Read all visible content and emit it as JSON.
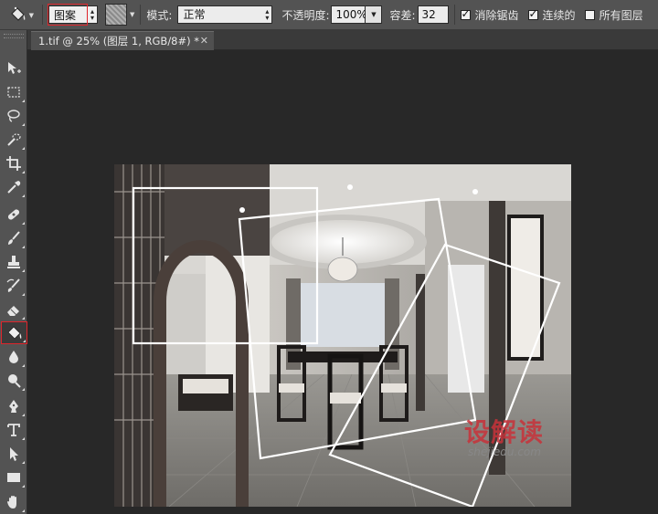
{
  "options_bar": {
    "tool_icon": "paint-bucket-icon",
    "fill_source": "图案",
    "pattern_icon": "pattern-swatch-icon",
    "mode_label": "模式:",
    "mode_value": "正常",
    "opacity_label": "不透明度:",
    "opacity_value": "100%",
    "tolerance_label": "容差:",
    "tolerance_value": "32",
    "anti_alias_label": "消除锯齿",
    "anti_alias_checked": true,
    "contiguous_label": "连续的",
    "contiguous_checked": true,
    "all_layers_label": "所有图层",
    "all_layers_checked": false
  },
  "document_tab": {
    "title": "1.tif @ 25% (图层 1, RGB/8#) *",
    "close_icon": "close-icon"
  },
  "toolbar": {
    "tools": [
      {
        "name": "move-tool",
        "icon": "move-icon"
      },
      {
        "name": "marquee-tool",
        "icon": "rect-marquee-icon"
      },
      {
        "name": "lasso-tool",
        "icon": "lasso-icon"
      },
      {
        "name": "quick-selection-tool",
        "icon": "quick-selection-icon"
      },
      {
        "name": "crop-tool",
        "icon": "crop-icon"
      },
      {
        "name": "eyedropper-tool",
        "icon": "eyedropper-icon"
      },
      {
        "name": "healing-brush-tool",
        "icon": "bandage-icon"
      },
      {
        "name": "brush-tool",
        "icon": "brush-icon"
      },
      {
        "name": "clone-stamp-tool",
        "icon": "stamp-icon"
      },
      {
        "name": "history-brush-tool",
        "icon": "history-brush-icon"
      },
      {
        "name": "eraser-tool",
        "icon": "eraser-icon"
      },
      {
        "name": "paint-bucket-tool",
        "icon": "paint-bucket-icon",
        "active": true
      },
      {
        "name": "blur-tool",
        "icon": "blur-drop-icon"
      },
      {
        "name": "dodge-tool",
        "icon": "dodge-icon"
      },
      {
        "name": "pen-tool",
        "icon": "pen-icon"
      },
      {
        "name": "type-tool",
        "icon": "type-icon"
      },
      {
        "name": "path-selection-tool",
        "icon": "path-selection-icon"
      },
      {
        "name": "rectangle-tool",
        "icon": "rectangle-icon"
      },
      {
        "name": "hand-tool",
        "icon": "hand-icon"
      }
    ]
  },
  "watermark": {
    "main": "设解读",
    "sub": "shejiedu.com"
  },
  "colors": {
    "highlight": "#e0252b",
    "panel": "#535353",
    "workspace": "#282828"
  }
}
